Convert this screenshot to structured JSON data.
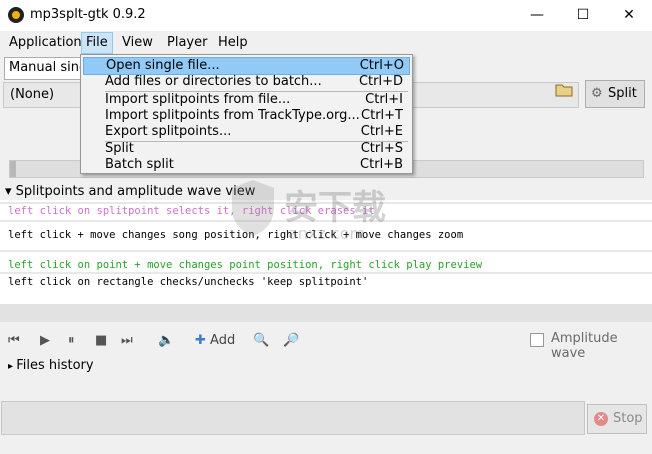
{
  "window": {
    "title": "mp3splt-gtk 0.9.2",
    "minimize": "—",
    "maximize": "☐",
    "close": "✕"
  },
  "menubar": {
    "items": [
      "Application",
      "File",
      "View",
      "Player",
      "Help"
    ]
  },
  "toolbar": {
    "mode_select": "Manual single file split",
    "file_value": "(None)",
    "split_label": "Split"
  },
  "file_menu": {
    "items": [
      {
        "label": "Open single file...",
        "shortcut": "Ctrl+O"
      },
      {
        "label": "Add files or directories to batch...",
        "shortcut": "Ctrl+D"
      },
      {
        "label": "Import splitpoints from file...",
        "shortcut": "Ctrl+I"
      },
      {
        "label": "Import splitpoints from TrackType.org...",
        "shortcut": "Ctrl+T"
      },
      {
        "label": "Export splitpoints...",
        "shortcut": "Ctrl+E"
      },
      {
        "label": "Split",
        "shortcut": "Ctrl+S"
      },
      {
        "label": "Batch split",
        "shortcut": "Ctrl+B"
      }
    ]
  },
  "wave_section": {
    "title": "Splitpoints and amplitude wave view",
    "hints": [
      {
        "text": "left click on splitpoint selects it, right click erases it",
        "color": "#d070d0"
      },
      {
        "text": "left click + move changes song position, right click + move changes zoom",
        "color": "#000000"
      },
      {
        "text": "left click on point + move changes point position, right click play preview",
        "color": "#2aa02a"
      },
      {
        "text": "left click on rectangle checks/unchecks 'keep splitpoint'",
        "color": "#000000"
      }
    ]
  },
  "player": {
    "add_label": "Add",
    "amplitude_label": "Amplitude wave",
    "amplitude_checked": false
  },
  "files_history": {
    "label": "Files history"
  },
  "status": {
    "stop_label": "Stop"
  },
  "watermark": {
    "text": "安下载",
    "sub": "anxz.com"
  }
}
